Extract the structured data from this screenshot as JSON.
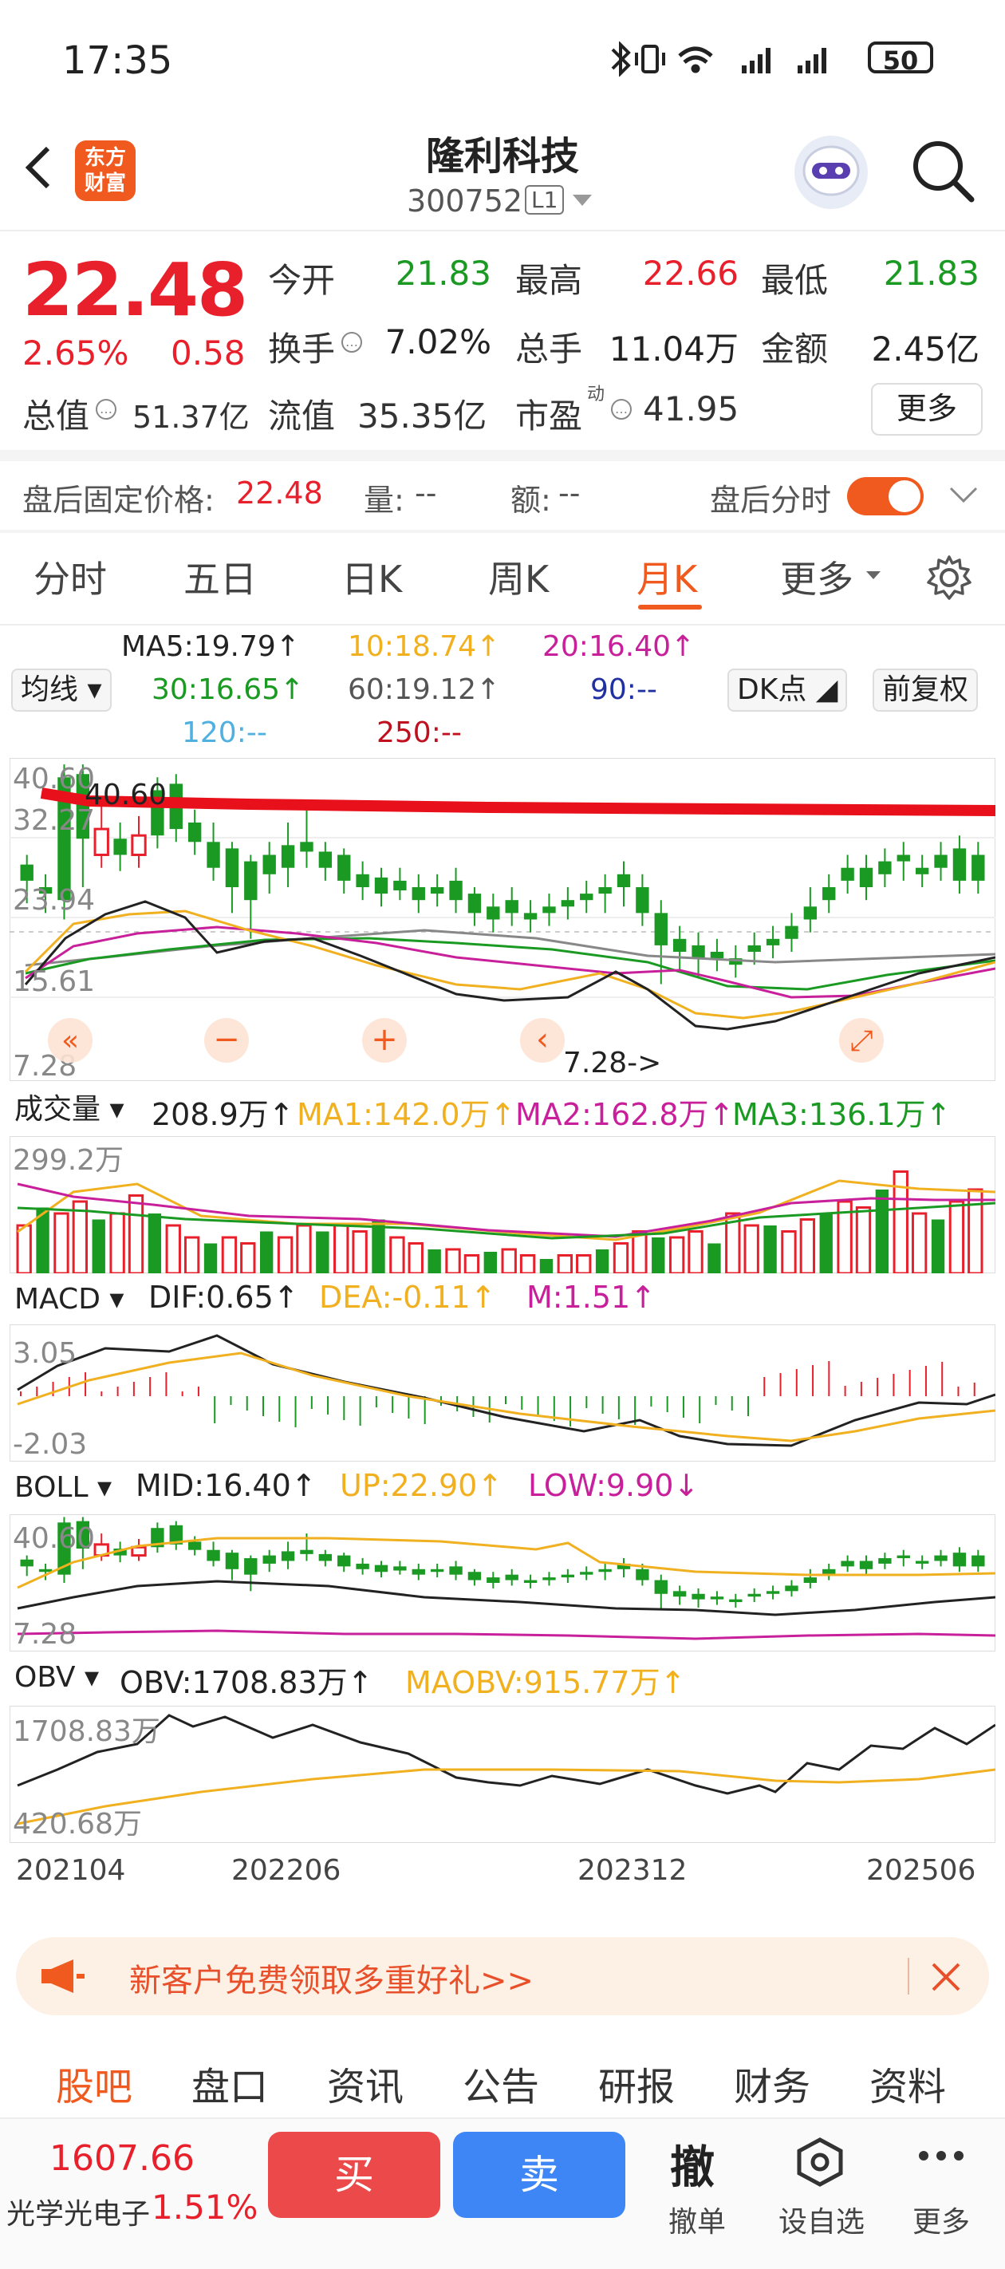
{
  "status_bar": {
    "time": "17:35",
    "battery": "50"
  },
  "header": {
    "logo_line1": "东方",
    "logo_line2": "财富",
    "title": "隆利科技",
    "code": "300752",
    "level": "L1"
  },
  "quote": {
    "price": "22.48",
    "change_pct": "2.65%",
    "change": "0.58",
    "open_label": "今开",
    "open": "21.83",
    "high_label": "最高",
    "high": "22.66",
    "low_label": "最低",
    "low": "21.83",
    "turnover_label": "换手",
    "turnover": "7.02%",
    "volume_label": "总手",
    "volume": "11.04万",
    "amount_label": "金额",
    "amount": "2.45亿",
    "mktcap_label": "总值",
    "mktcap": "51.37亿",
    "float_label": "流值",
    "float": "35.35亿",
    "pe_label": "市盈",
    "pe_sup": "动",
    "pe": "41.95",
    "more": "更多"
  },
  "after_hours": {
    "label": "盘后固定价格:",
    "price": "22.48",
    "vol_label": "量:",
    "vol": "--",
    "amt_label": "额:",
    "amt": "--",
    "toggle_label": "盘后分时"
  },
  "tabs": [
    "分时",
    "五日",
    "日K",
    "周K",
    "月K",
    "更多"
  ],
  "ma_legend": {
    "selector": "均线",
    "ma5": "MA5:19.79↑",
    "ma10": "10:18.74↑",
    "ma20": "20:16.40↑",
    "ma30": "30:16.65↑",
    "ma60": "60:19.12↑",
    "ma90": "90:--",
    "ma120": "120:--",
    "ma250": "250:--",
    "dk_btn": "DK点",
    "fq_btn": "前复权"
  },
  "kline": {
    "y_labels": [
      "40.60",
      "32.27",
      "23.94",
      "15.61",
      "7.28"
    ],
    "high_marker": "40.60",
    "low_marker": "7.28->",
    "controls": [
      "«",
      "−",
      "+",
      "‹",
      "⤢"
    ]
  },
  "volume_panel": {
    "selector": "成交量",
    "value": "208.9万↑",
    "ma1": "MA1:142.0万↑",
    "ma2": "MA2:162.8万↑",
    "ma3": "MA3:136.1万↑",
    "y_label": "299.2万"
  },
  "macd_panel": {
    "selector": "MACD",
    "dif": "DIF:0.65↑",
    "dea": "DEA:-0.11↑",
    "m": "M:1.51↑",
    "y_top": "3.05",
    "y_bottom": "-2.03"
  },
  "boll_panel": {
    "selector": "BOLL",
    "mid": "MID:16.40↑",
    "up": "UP:22.90↑",
    "low": "LOW:9.90↓",
    "y_top": "40.60",
    "y_bottom": "7.28"
  },
  "obv_panel": {
    "selector": "OBV",
    "obv": "OBV:1708.83万↑",
    "maobv": "MAOBV:915.77万↑",
    "y_top": "1708.83万",
    "y_bottom": "420.68万"
  },
  "x_axis": [
    "202104",
    "202206",
    "202312",
    "202506"
  ],
  "banner": {
    "text": "新客户免费领取多重好礼>>"
  },
  "bottom_tabs": [
    "股吧",
    "盘口",
    "资讯",
    "公告",
    "研报",
    "财务",
    "资料"
  ],
  "footer": {
    "index_value": "1607.66",
    "index_name": "光学光电子",
    "index_pct": "1.51%",
    "buy": "买",
    "sell": "卖",
    "cancel": "撤",
    "cancel_label": "撤单",
    "watch_label": "设自选",
    "more_label": "更多"
  },
  "colors": {
    "accent": "#f05a1e",
    "up": "#e8202c",
    "down": "#1a9a22",
    "buy": "#ec4a4a",
    "sell": "#3e86f5"
  }
}
